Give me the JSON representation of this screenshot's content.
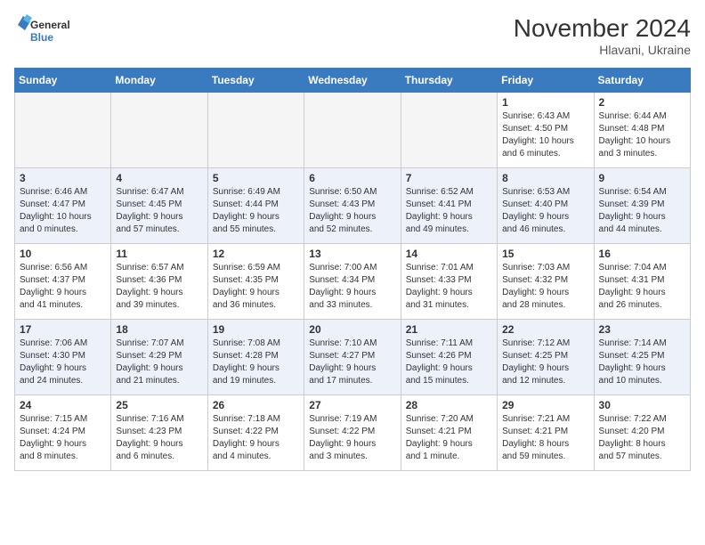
{
  "header": {
    "logo_line1": "General",
    "logo_line2": "Blue",
    "month_title": "November 2024",
    "location": "Hlavani, Ukraine"
  },
  "weekdays": [
    "Sunday",
    "Monday",
    "Tuesday",
    "Wednesday",
    "Thursday",
    "Friday",
    "Saturday"
  ],
  "weeks": [
    {
      "row_class": "week-row-1",
      "days": [
        {
          "num": "",
          "info": "",
          "empty": true
        },
        {
          "num": "",
          "info": "",
          "empty": true
        },
        {
          "num": "",
          "info": "",
          "empty": true
        },
        {
          "num": "",
          "info": "",
          "empty": true
        },
        {
          "num": "",
          "info": "",
          "empty": true
        },
        {
          "num": "1",
          "info": "Sunrise: 6:43 AM\nSunset: 4:50 PM\nDaylight: 10 hours\nand 6 minutes.",
          "empty": false
        },
        {
          "num": "2",
          "info": "Sunrise: 6:44 AM\nSunset: 4:48 PM\nDaylight: 10 hours\nand 3 minutes.",
          "empty": false
        }
      ]
    },
    {
      "row_class": "week-row-2",
      "days": [
        {
          "num": "3",
          "info": "Sunrise: 6:46 AM\nSunset: 4:47 PM\nDaylight: 10 hours\nand 0 minutes.",
          "empty": false
        },
        {
          "num": "4",
          "info": "Sunrise: 6:47 AM\nSunset: 4:45 PM\nDaylight: 9 hours\nand 57 minutes.",
          "empty": false
        },
        {
          "num": "5",
          "info": "Sunrise: 6:49 AM\nSunset: 4:44 PM\nDaylight: 9 hours\nand 55 minutes.",
          "empty": false
        },
        {
          "num": "6",
          "info": "Sunrise: 6:50 AM\nSunset: 4:43 PM\nDaylight: 9 hours\nand 52 minutes.",
          "empty": false
        },
        {
          "num": "7",
          "info": "Sunrise: 6:52 AM\nSunset: 4:41 PM\nDaylight: 9 hours\nand 49 minutes.",
          "empty": false
        },
        {
          "num": "8",
          "info": "Sunrise: 6:53 AM\nSunset: 4:40 PM\nDaylight: 9 hours\nand 46 minutes.",
          "empty": false
        },
        {
          "num": "9",
          "info": "Sunrise: 6:54 AM\nSunset: 4:39 PM\nDaylight: 9 hours\nand 44 minutes.",
          "empty": false
        }
      ]
    },
    {
      "row_class": "week-row-3",
      "days": [
        {
          "num": "10",
          "info": "Sunrise: 6:56 AM\nSunset: 4:37 PM\nDaylight: 9 hours\nand 41 minutes.",
          "empty": false
        },
        {
          "num": "11",
          "info": "Sunrise: 6:57 AM\nSunset: 4:36 PM\nDaylight: 9 hours\nand 39 minutes.",
          "empty": false
        },
        {
          "num": "12",
          "info": "Sunrise: 6:59 AM\nSunset: 4:35 PM\nDaylight: 9 hours\nand 36 minutes.",
          "empty": false
        },
        {
          "num": "13",
          "info": "Sunrise: 7:00 AM\nSunset: 4:34 PM\nDaylight: 9 hours\nand 33 minutes.",
          "empty": false
        },
        {
          "num": "14",
          "info": "Sunrise: 7:01 AM\nSunset: 4:33 PM\nDaylight: 9 hours\nand 31 minutes.",
          "empty": false
        },
        {
          "num": "15",
          "info": "Sunrise: 7:03 AM\nSunset: 4:32 PM\nDaylight: 9 hours\nand 28 minutes.",
          "empty": false
        },
        {
          "num": "16",
          "info": "Sunrise: 7:04 AM\nSunset: 4:31 PM\nDaylight: 9 hours\nand 26 minutes.",
          "empty": false
        }
      ]
    },
    {
      "row_class": "week-row-4",
      "days": [
        {
          "num": "17",
          "info": "Sunrise: 7:06 AM\nSunset: 4:30 PM\nDaylight: 9 hours\nand 24 minutes.",
          "empty": false
        },
        {
          "num": "18",
          "info": "Sunrise: 7:07 AM\nSunset: 4:29 PM\nDaylight: 9 hours\nand 21 minutes.",
          "empty": false
        },
        {
          "num": "19",
          "info": "Sunrise: 7:08 AM\nSunset: 4:28 PM\nDaylight: 9 hours\nand 19 minutes.",
          "empty": false
        },
        {
          "num": "20",
          "info": "Sunrise: 7:10 AM\nSunset: 4:27 PM\nDaylight: 9 hours\nand 17 minutes.",
          "empty": false
        },
        {
          "num": "21",
          "info": "Sunrise: 7:11 AM\nSunset: 4:26 PM\nDaylight: 9 hours\nand 15 minutes.",
          "empty": false
        },
        {
          "num": "22",
          "info": "Sunrise: 7:12 AM\nSunset: 4:25 PM\nDaylight: 9 hours\nand 12 minutes.",
          "empty": false
        },
        {
          "num": "23",
          "info": "Sunrise: 7:14 AM\nSunset: 4:25 PM\nDaylight: 9 hours\nand 10 minutes.",
          "empty": false
        }
      ]
    },
    {
      "row_class": "week-row-5",
      "days": [
        {
          "num": "24",
          "info": "Sunrise: 7:15 AM\nSunset: 4:24 PM\nDaylight: 9 hours\nand 8 minutes.",
          "empty": false
        },
        {
          "num": "25",
          "info": "Sunrise: 7:16 AM\nSunset: 4:23 PM\nDaylight: 9 hours\nand 6 minutes.",
          "empty": false
        },
        {
          "num": "26",
          "info": "Sunrise: 7:18 AM\nSunset: 4:22 PM\nDaylight: 9 hours\nand 4 minutes.",
          "empty": false
        },
        {
          "num": "27",
          "info": "Sunrise: 7:19 AM\nSunset: 4:22 PM\nDaylight: 9 hours\nand 3 minutes.",
          "empty": false
        },
        {
          "num": "28",
          "info": "Sunrise: 7:20 AM\nSunset: 4:21 PM\nDaylight: 9 hours\nand 1 minute.",
          "empty": false
        },
        {
          "num": "29",
          "info": "Sunrise: 7:21 AM\nSunset: 4:21 PM\nDaylight: 8 hours\nand 59 minutes.",
          "empty": false
        },
        {
          "num": "30",
          "info": "Sunrise: 7:22 AM\nSunset: 4:20 PM\nDaylight: 8 hours\nand 57 minutes.",
          "empty": false
        }
      ]
    }
  ]
}
